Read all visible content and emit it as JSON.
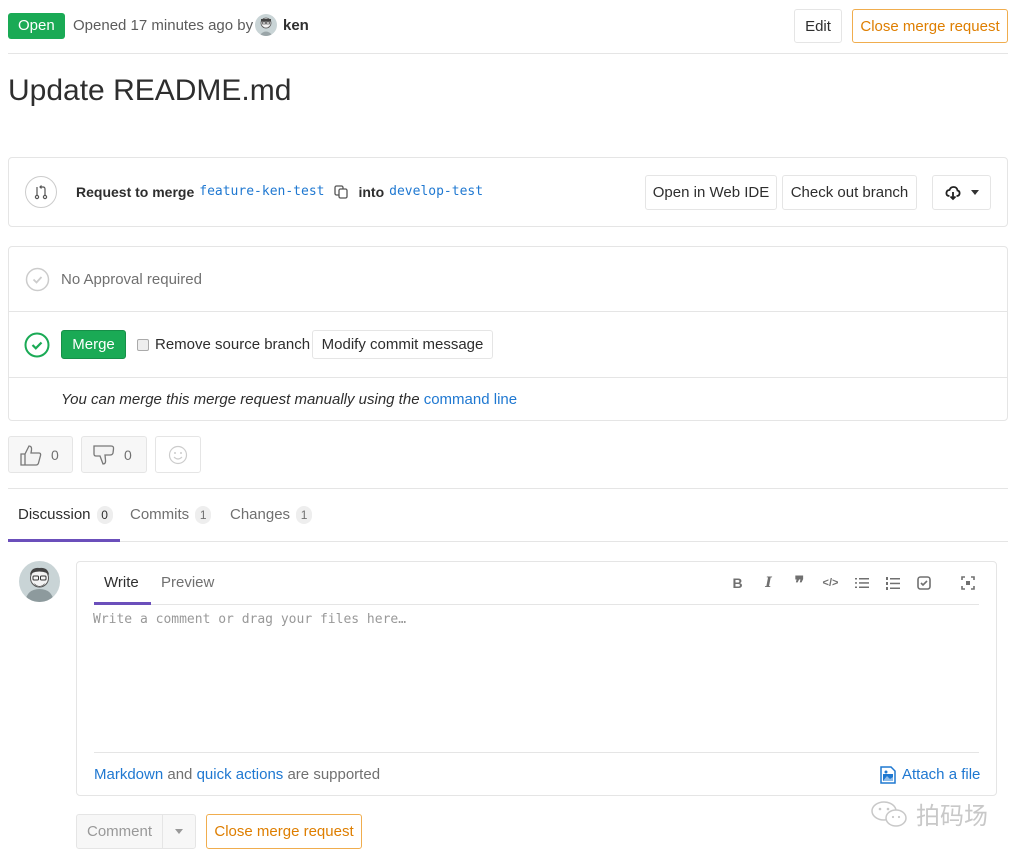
{
  "header": {
    "status_badge": "Open",
    "opened_text": "Opened 17 minutes ago by",
    "author": "ken",
    "edit_label": "Edit",
    "close_label": "Close merge request"
  },
  "title": "Update README.md",
  "branch_info": {
    "request_label": "Request to merge",
    "source_branch": "feature-ken-test",
    "into_label": "into",
    "target_branch": "develop-test",
    "open_ide_label": "Open in Web IDE",
    "checkout_label": "Check out branch",
    "download_icon": "cloud-download-icon"
  },
  "merge_widget": {
    "approval_text": "No Approval required",
    "merge_label": "Merge",
    "remove_source_label": "Remove source branch",
    "remove_source_checked": false,
    "modify_commit_label": "Modify commit message",
    "manual_text": "You can merge this merge request manually using the",
    "command_line_link": "command line"
  },
  "awards": {
    "thumbs_up_count": "0",
    "thumbs_down_count": "0"
  },
  "tabs": [
    {
      "label": "Discussion",
      "count": "0",
      "active": true
    },
    {
      "label": "Commits",
      "count": "1",
      "active": false
    },
    {
      "label": "Changes",
      "count": "1",
      "active": false
    }
  ],
  "comment_form": {
    "write_tab": "Write",
    "preview_tab": "Preview",
    "placeholder": "Write a comment or drag your files here…",
    "toolbar": [
      "bold",
      "italic",
      "quote",
      "code",
      "bullet-list",
      "numbered-list",
      "task-list",
      "fullscreen"
    ],
    "markdown_link": "Markdown",
    "and_text": "and",
    "quick_actions_link": "quick actions",
    "supported_text": "are supported",
    "attach_label": "Attach a file",
    "comment_label": "Comment",
    "close_label": "Close merge request"
  },
  "watermark": "拍码场",
  "colors": {
    "success": "#1aaa55",
    "warning": "#de7e00",
    "link": "#1f78d1",
    "active_tab": "#6b4fbb"
  }
}
